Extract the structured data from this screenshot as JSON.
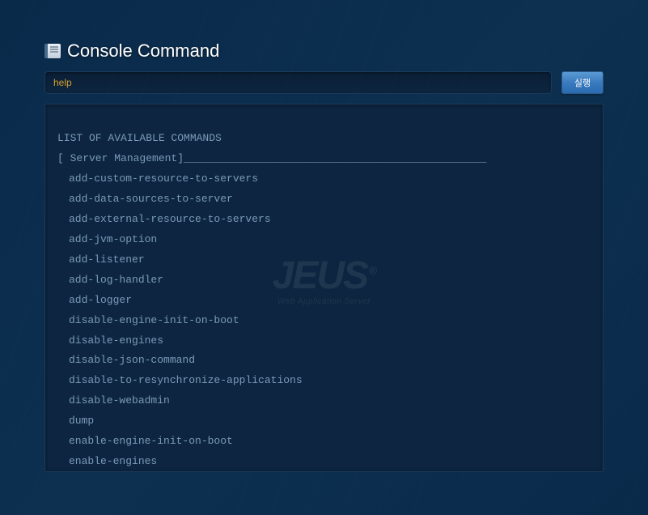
{
  "header": {
    "title": "Console Command"
  },
  "input": {
    "value": "help"
  },
  "button": {
    "execute": "실행"
  },
  "watermark": {
    "main": "JEUS",
    "sub": "Web Application Server"
  },
  "output": {
    "heading": "LIST OF AVAILABLE COMMANDS",
    "section": "[ Server Management]________________________________________________",
    "commands": [
      "add-custom-resource-to-servers",
      "add-data-sources-to-server",
      "add-external-resource-to-servers",
      "add-jvm-option",
      "add-listener",
      "add-log-handler",
      "add-logger",
      "disable-engine-init-on-boot",
      "disable-engines",
      "disable-json-command",
      "disable-to-resynchronize-applications",
      "disable-webadmin",
      "dump",
      "enable-engine-init-on-boot",
      "enable-engines"
    ]
  }
}
